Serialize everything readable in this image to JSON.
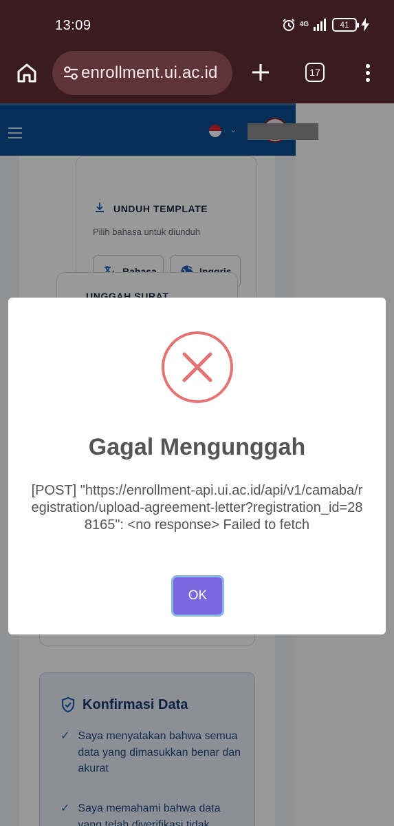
{
  "status_bar": {
    "time": "13:09",
    "network": "4G",
    "battery": "41",
    "icons": [
      "alarm-icon",
      "signal-icon",
      "battery-icon",
      "charging-icon"
    ]
  },
  "browser": {
    "url": "enrollment.ui.ac.id",
    "tab_count": "17",
    "icons": [
      "home-icon",
      "site-settings-icon",
      "new-tab-icon",
      "tab-switcher-icon",
      "overflow-menu-icon"
    ]
  },
  "page": {
    "header": {
      "flag": "id"
    },
    "download_template": {
      "title": "UNDUH TEMPLATE",
      "subtitle": "Pilih bahasa untuk diunduh",
      "buttons": [
        {
          "label": "Bahasa",
          "icon": "translate-icon"
        },
        {
          "label": "Inggris",
          "icon": "globe-icon"
        }
      ]
    },
    "upload_letter": {
      "title": "UNGGAH SURAT"
    },
    "confirmation": {
      "title": "Konfirmasi Data",
      "items": [
        "Saya menyatakan bahwa semua data yang dimasukkan benar dan akurat",
        "Saya memahami bahwa data yang telah diverifikasi tidak"
      ]
    }
  },
  "modal": {
    "title": "Gagal Mengunggah",
    "message": "[POST] \"https://enrollment-api.ui.ac.id/api/v1/camaba/registration/upload-agreement-letter?registration_id=288165\": <no response> Failed to fetch",
    "ok_label": "OK",
    "colors": {
      "error": "#e57373",
      "ok_button": "#7b67e0"
    }
  }
}
